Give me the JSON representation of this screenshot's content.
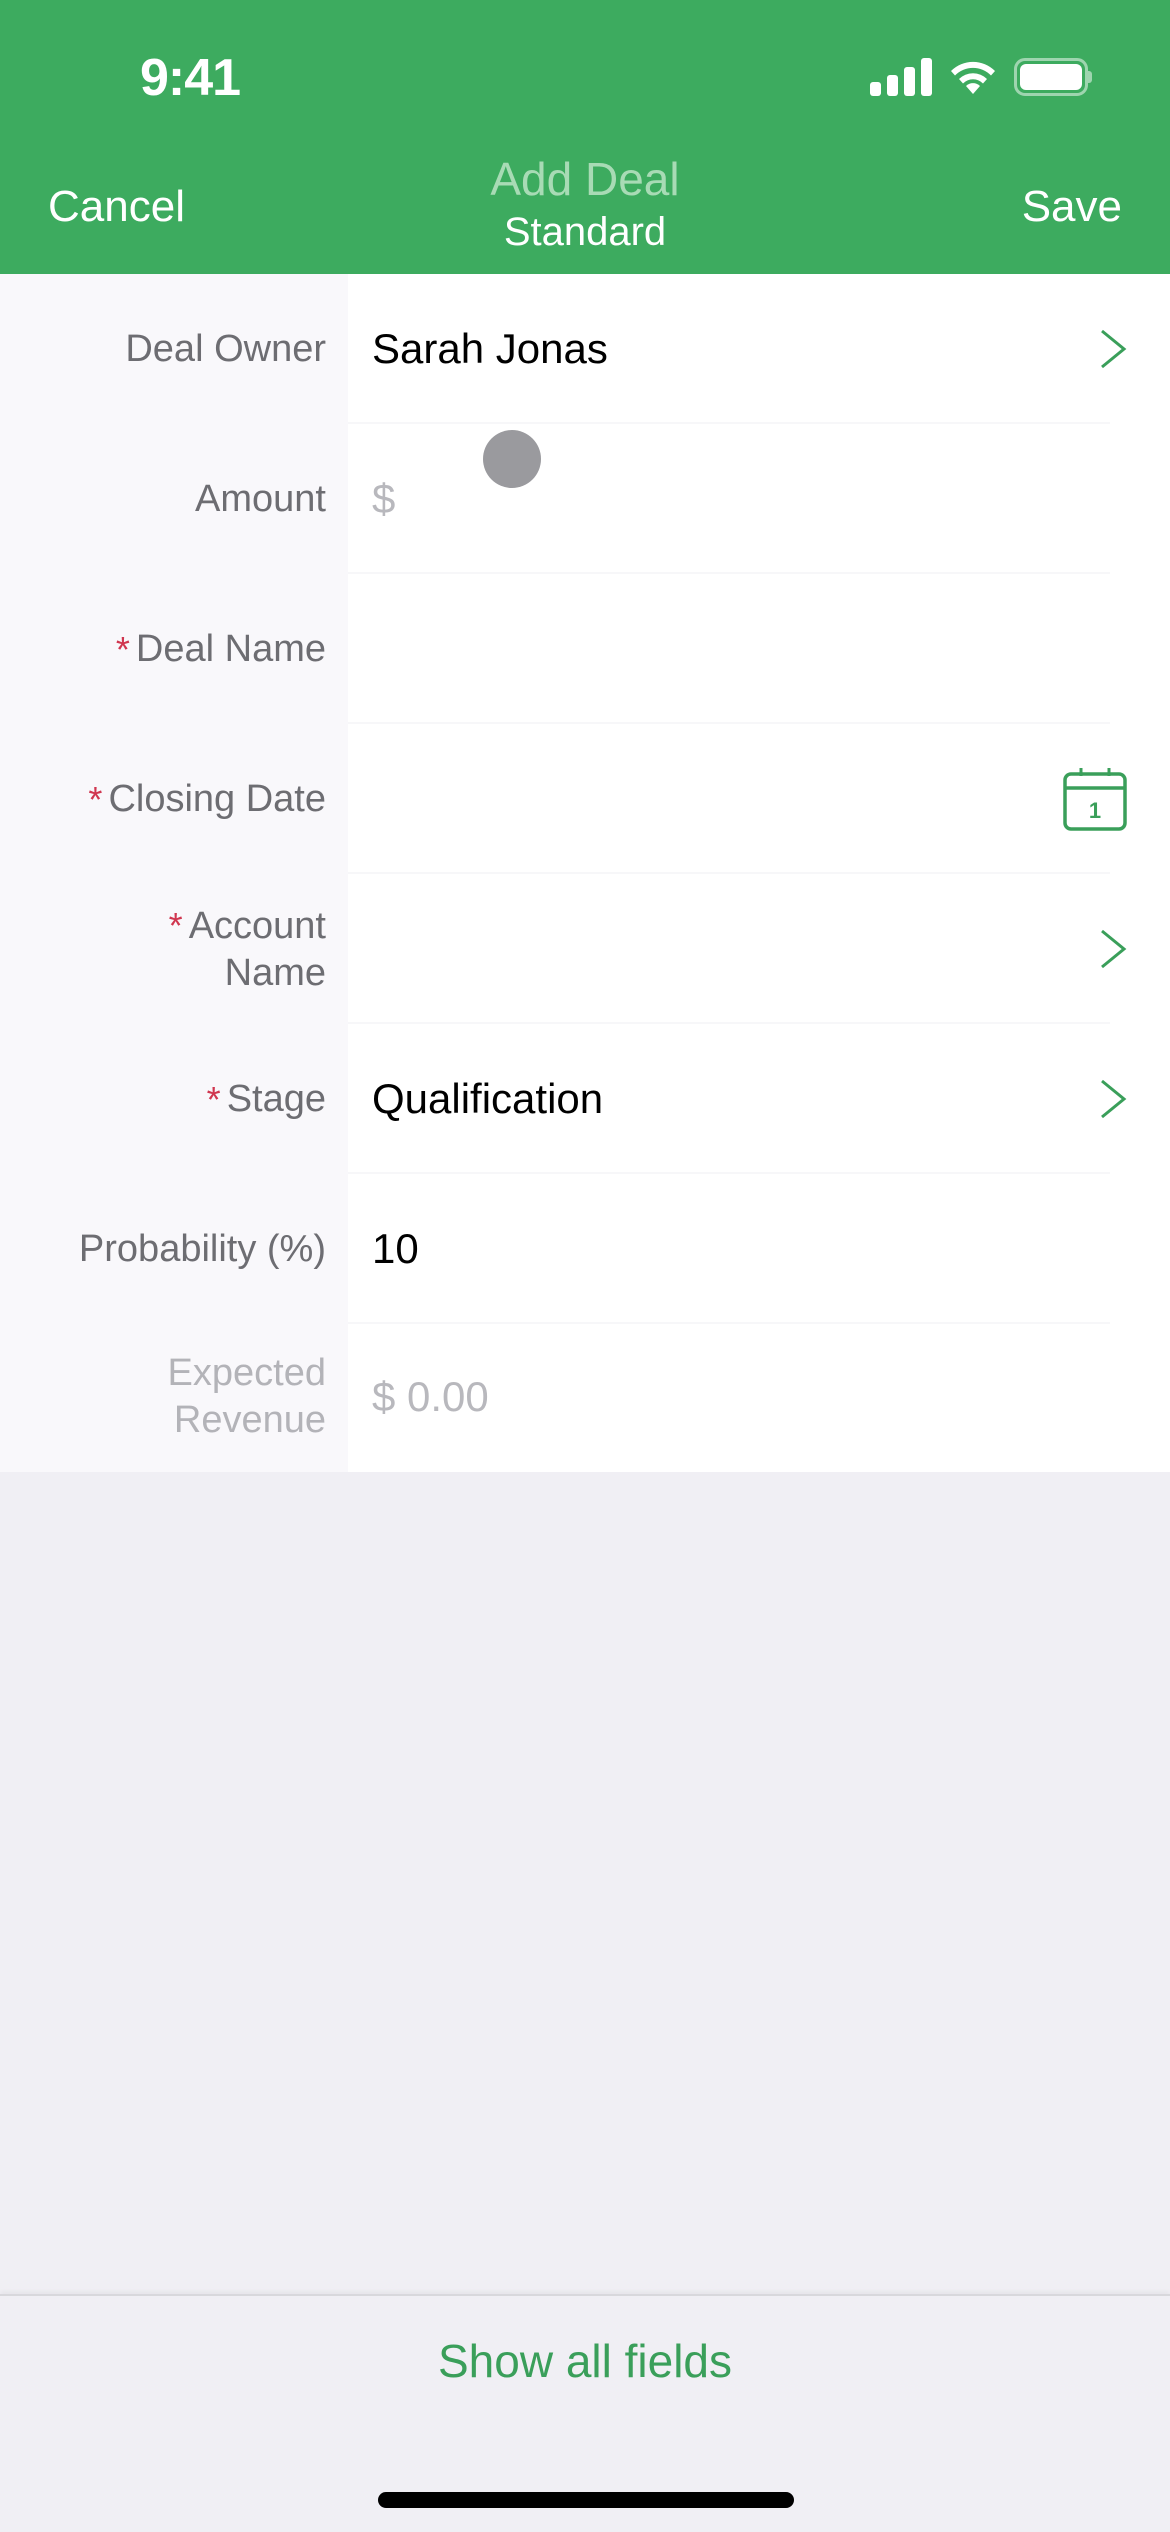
{
  "status_bar": {
    "time": "9:41",
    "icons": [
      "cellular-signal-icon",
      "wifi-icon",
      "battery-icon"
    ]
  },
  "nav": {
    "cancel_label": "Cancel",
    "title": "Add Deal",
    "subtitle": "Standard",
    "save_label": "Save"
  },
  "colors": {
    "brand_green": "#3dab5f",
    "required_red": "#d0364f",
    "accent_green": "#3a9f5a"
  },
  "form": {
    "fields": [
      {
        "label": "Deal Owner",
        "required": false,
        "value": "Sarah Jonas",
        "placeholder": "",
        "accessory": "chevron-right-icon"
      },
      {
        "label": "Amount",
        "required": false,
        "value": "",
        "placeholder": "$",
        "accessory": ""
      },
      {
        "label": "Deal Name",
        "required": true,
        "value": "",
        "placeholder": "",
        "accessory": ""
      },
      {
        "label": "Closing Date",
        "required": true,
        "value": "",
        "placeholder": "",
        "accessory": "calendar-icon",
        "calendar_day": "1"
      },
      {
        "label_line1": "Account",
        "label_line2": "Name",
        "required": true,
        "value": "",
        "placeholder": "",
        "accessory": "chevron-right-icon"
      },
      {
        "label": "Stage",
        "required": true,
        "value": "Qualification",
        "placeholder": "",
        "accessory": "chevron-right-icon"
      },
      {
        "label": "Probability (%)",
        "required": false,
        "value": "10",
        "placeholder": "",
        "accessory": ""
      },
      {
        "label_line1": "Expected",
        "label_line2": "Revenue",
        "required": false,
        "value": "",
        "placeholder": "$ 0.00",
        "accessory": "",
        "read_only": true
      }
    ],
    "required_marker": "*"
  },
  "footer": {
    "show_all_label": "Show all fields"
  }
}
